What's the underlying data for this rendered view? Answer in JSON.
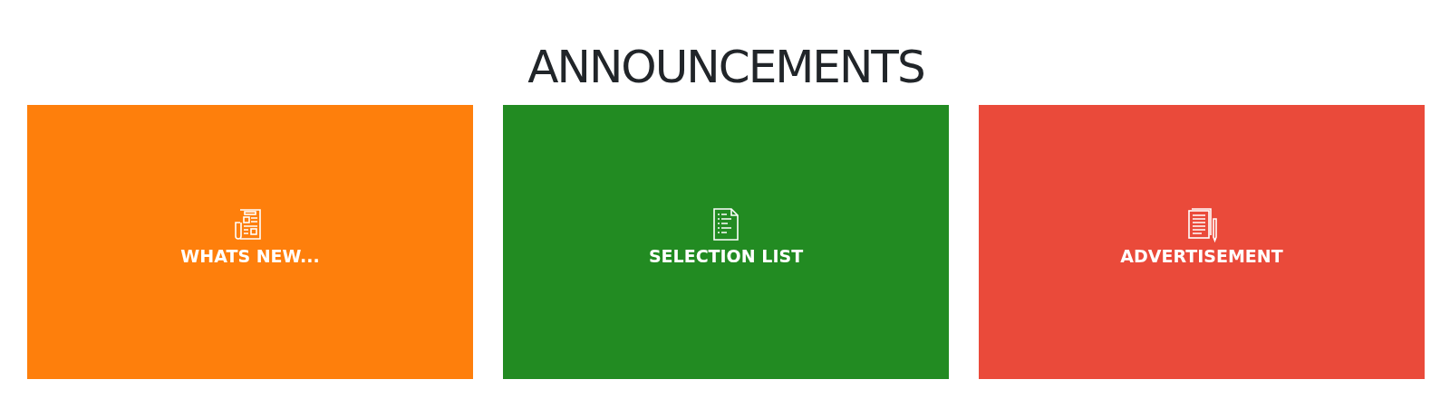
{
  "heading": "ANNOUNCEMENTS",
  "tiles": [
    {
      "label": "WHATS NEW...",
      "kind": "newspaper",
      "color": "#fe7f0c"
    },
    {
      "label": "SELECTION LIST",
      "kind": "document",
      "color": "#228b22"
    },
    {
      "label": "ADVERTISEMENT",
      "kind": "papers",
      "color": "#ea4a3a"
    }
  ]
}
